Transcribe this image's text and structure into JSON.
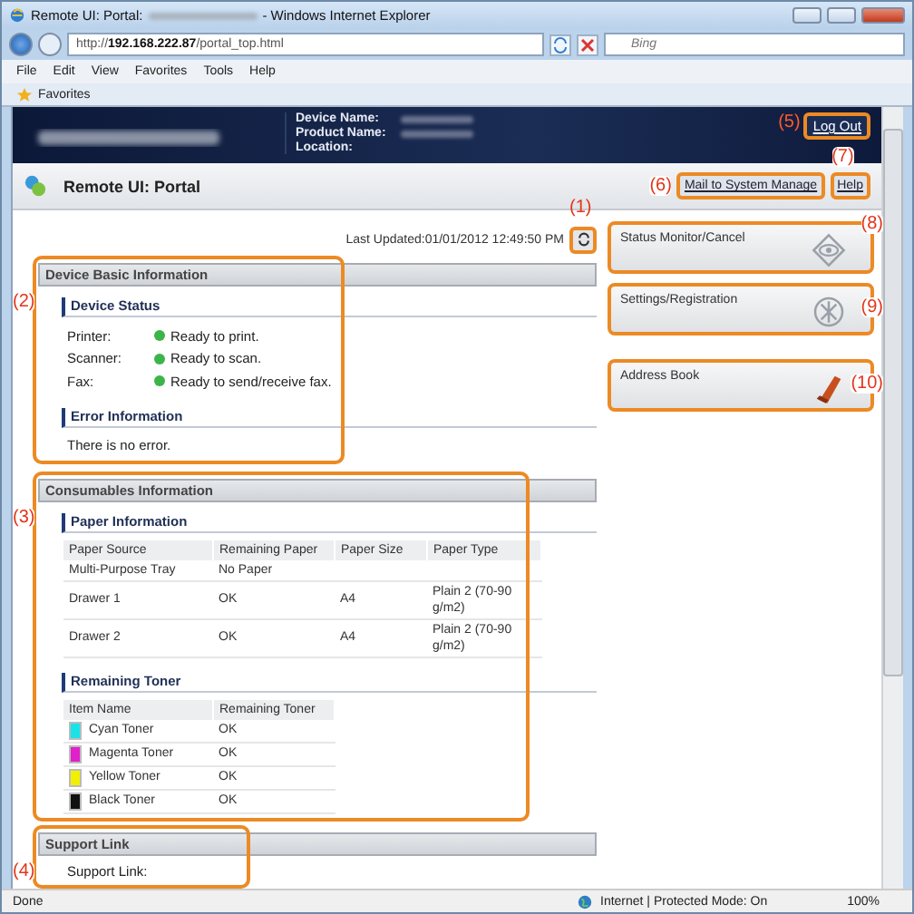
{
  "window": {
    "title_start": "Remote UI: Portal:",
    "title_end": "- Windows Internet Explorer"
  },
  "address_bar": {
    "url": "http://**192.168.222.87**/portal_top.html",
    "search_placeholder": "Bing"
  },
  "menu": [
    "File",
    "Edit",
    "View",
    "Favorites",
    "Tools",
    "Help"
  ],
  "favorites_bar": {
    "label": "Favorites"
  },
  "header": {
    "fields": [
      "Device Name:",
      "Product Name:",
      "Location:"
    ],
    "logout": {
      "label": "Log Out",
      "callout": "(5)"
    }
  },
  "portal": {
    "title": "Remote UI: Portal",
    "links": [
      {
        "label": "Mail to System Manage",
        "callout": "(6)"
      },
      {
        "label": "Help",
        "callout": "(7)"
      }
    ]
  },
  "last_updated": {
    "text": "Last Updated:01/01/2012 12:49:50 PM",
    "callout": "(1)"
  },
  "device_basic": {
    "title": "Device Basic Information",
    "callout": "(2)",
    "status_title": "Device Status",
    "statuses": [
      {
        "device": "Printer:",
        "status": "Ready to print.",
        "color": "#3cb44a"
      },
      {
        "device": "Scanner:",
        "status": "Ready to scan.",
        "color": "#3cb44a"
      },
      {
        "device": "Fax:",
        "status": "Ready to send/receive fax.",
        "color": "#3cb44a"
      }
    ],
    "error_title": "Error Information",
    "error_text": "There is no error."
  },
  "consumables": {
    "title": "Consumables Information",
    "callout": "(3)",
    "paper_title": "Paper Information",
    "paper_table": {
      "columns": [
        "Paper Source",
        "Remaining Paper",
        "Paper Size",
        "Paper Type"
      ],
      "rows": [
        [
          "Multi-Purpose Tray",
          "No Paper",
          "",
          ""
        ],
        [
          "Drawer 1",
          "OK",
          "A4",
          "Plain 2 (70-90 g/m2)"
        ],
        [
          "Drawer 2",
          "OK",
          "A4",
          "Plain 2 (70-90 g/m2)"
        ]
      ]
    },
    "toner_title": "Remaining Toner",
    "toner_table": {
      "columns": [
        "Item Name",
        "Remaining Toner"
      ],
      "rows": [
        {
          "name": "Cyan Toner",
          "remaining": "OK",
          "color": "#19e3e8"
        },
        {
          "name": "Magenta Toner",
          "remaining": "OK",
          "color": "#e020c8"
        },
        {
          "name": "Yellow Toner",
          "remaining": "OK",
          "color": "#f0f000"
        },
        {
          "name": "Black Toner",
          "remaining": "OK",
          "color": "#111111"
        }
      ]
    }
  },
  "support": {
    "title": "Support Link",
    "callout": "(4)",
    "link": "Support Link:"
  },
  "menu_buttons": [
    {
      "label": "Status Monitor/Cancel",
      "callout": "(8)",
      "kind": "status"
    },
    {
      "label": "Settings/Registration",
      "callout": "(9)",
      "kind": "settings"
    },
    {
      "label": "Address Book",
      "callout": "(10)",
      "kind": "address"
    }
  ],
  "status_bar": {
    "text": "Done",
    "zone": "Internet | Protected Mode: On",
    "zoom": "100%"
  }
}
